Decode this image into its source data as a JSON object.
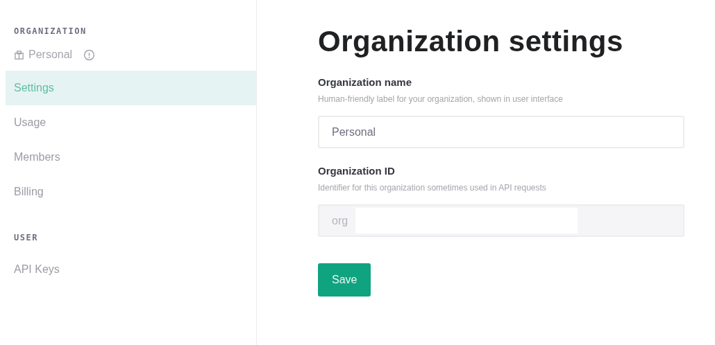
{
  "sidebar": {
    "sections": [
      {
        "heading": "ORGANIZATION",
        "org_switcher": {
          "label": "Personal"
        },
        "items": [
          {
            "label": "Settings",
            "selected": true
          },
          {
            "label": "Usage",
            "selected": false
          },
          {
            "label": "Members",
            "selected": false
          },
          {
            "label": "Billing",
            "selected": false
          }
        ]
      },
      {
        "heading": "USER",
        "items": [
          {
            "label": "API Keys",
            "selected": false
          }
        ]
      }
    ]
  },
  "main": {
    "title": "Organization settings",
    "fields": [
      {
        "label": "Organization name",
        "description": "Human-friendly label for your organization, shown in user interface",
        "value": "Personal",
        "disabled": false,
        "redacted": false
      },
      {
        "label": "Organization ID",
        "description": "Identifier for this organization sometimes used in API requests",
        "value": "org",
        "disabled": true,
        "redacted": true
      }
    ],
    "button": "Save"
  }
}
